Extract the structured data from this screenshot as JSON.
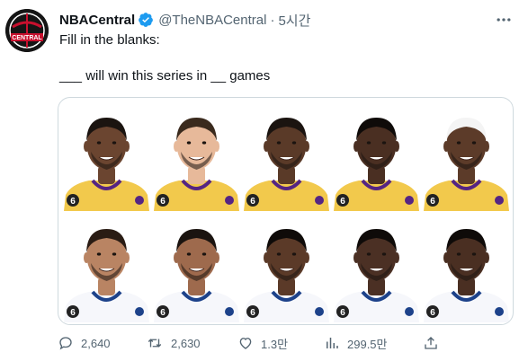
{
  "tweet": {
    "display_name": "NBACentral",
    "handle": "@TheNBACentral",
    "separator": "·",
    "time": "5시간",
    "text_line1": "Fill in the blanks:",
    "text_line2": "___ will win this series in __ games",
    "avatar_text": "CENTRAL"
  },
  "media": {
    "rows": [
      {
        "team": "lakers",
        "jersey_color": "#f2c94c",
        "accent": "#552583",
        "players": [
          {
            "number": "6",
            "skin": "#6b4530",
            "hair": "#1b1410"
          },
          {
            "number": "6",
            "skin": "#e7b99a",
            "hair": "#3a2a1d"
          },
          {
            "number": "6",
            "skin": "#5a3a28",
            "hair": "#1b1410"
          },
          {
            "number": "6",
            "skin": "#4a2f22",
            "hair": "#0f0b09"
          },
          {
            "number": "6",
            "skin": "#5c3b29",
            "hair": "#f4f4f4"
          }
        ],
        "sponsor": "bibigo"
      },
      {
        "team": "warriors",
        "jersey_color": "#f6f7fb",
        "accent": "#1d428a",
        "players": [
          {
            "number": "6",
            "skin": "#b98463",
            "hair": "#2a1c14"
          },
          {
            "number": "6",
            "skin": "#9e6a4d",
            "hair": "#1b1410"
          },
          {
            "number": "6",
            "skin": "#5b3a28",
            "hair": "#0f0b09"
          },
          {
            "number": "6",
            "skin": "#4b3024",
            "hair": "#0f0b09"
          },
          {
            "number": "6",
            "skin": "#4a2f22",
            "hair": "#0f0b09"
          }
        ],
        "sponsor": "Rakuten"
      }
    ]
  },
  "actions": {
    "replies": "2,640",
    "retweets": "2,630",
    "likes": "1.3만",
    "views": "299.5만"
  },
  "colors": {
    "verified": "#1d9bf0",
    "secondary_text": "#536471",
    "border": "#cfd9de"
  }
}
